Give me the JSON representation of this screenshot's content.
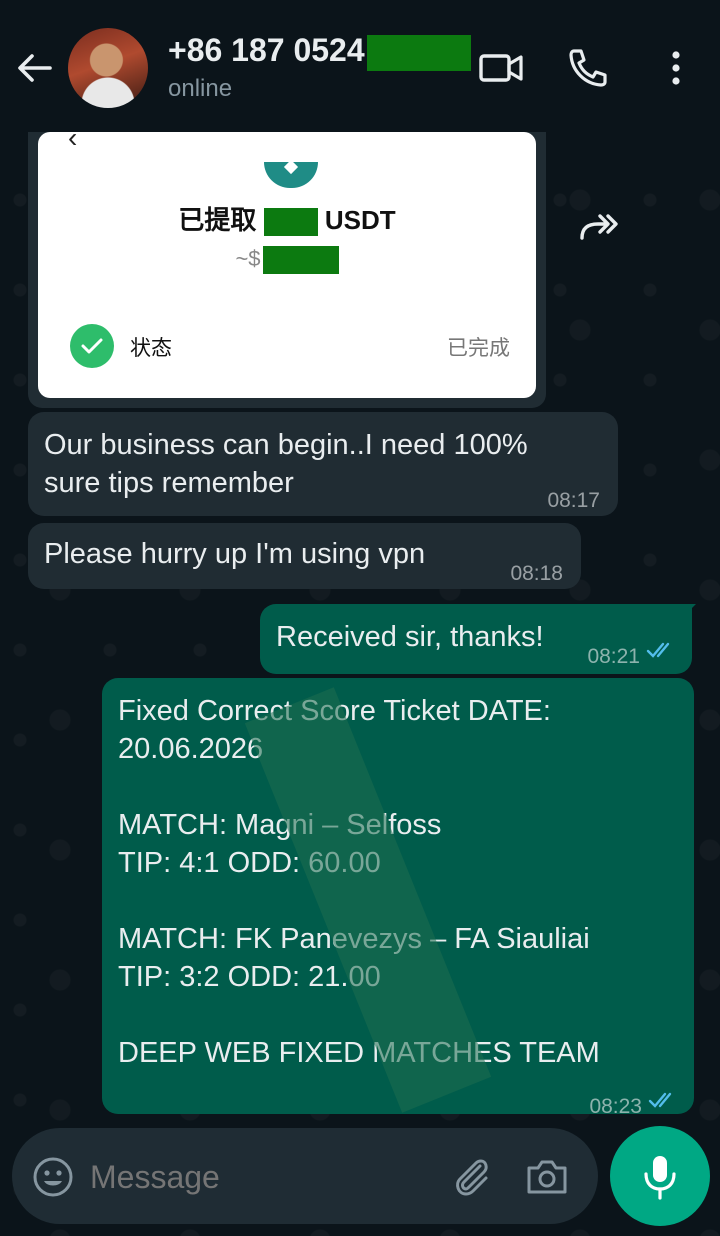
{
  "header": {
    "contact_name": "+86 187 0524",
    "status": "online"
  },
  "image_card": {
    "back_glyph": "‹",
    "title_prefix": "已提取",
    "title_suffix": "USDT",
    "amount_prefix": "~$",
    "status_label": "状态",
    "status_value": "已完成"
  },
  "messages": [
    {
      "text_lines": [
        "Our business can begin..I need 100%",
        "sure tips remember"
      ],
      "time": "08:17",
      "direction": "incoming"
    },
    {
      "text_lines": [
        "Please hurry up I'm using vpn"
      ],
      "time": "08:18",
      "direction": "incoming"
    },
    {
      "text_lines": [
        "Received sir, thanks!"
      ],
      "time": "08:21",
      "direction": "outgoing",
      "read": true
    },
    {
      "text_lines": [
        "Fixed Correct Score Ticket DATE:",
        "20.06.2026",
        "",
        "MATCH: Magni – Selfoss",
        "TIP: 4:1  ODD: 60.00",
        "",
        "MATCH: FK Panevezys – FA Siauliai",
        "TIP: 3:2 ODD: 21.00",
        "",
        "DEEP WEB FIXED MATCHES TEAM"
      ],
      "time": "08:23",
      "direction": "outgoing",
      "read": true
    }
  ],
  "input": {
    "placeholder": "Message"
  },
  "colors": {
    "incoming_bubble": "#202c33",
    "outgoing_bubble": "#005c4b",
    "read_ticks": "#53bdeb",
    "accent": "#00a884",
    "redaction": "#0c7a10"
  },
  "icons": [
    "back-arrow-icon",
    "video-call-icon",
    "phone-icon",
    "more-vert-icon",
    "forward-icon",
    "emoji-icon",
    "attach-icon",
    "camera-icon",
    "mic-icon",
    "check-icon",
    "double-check-icon"
  ]
}
